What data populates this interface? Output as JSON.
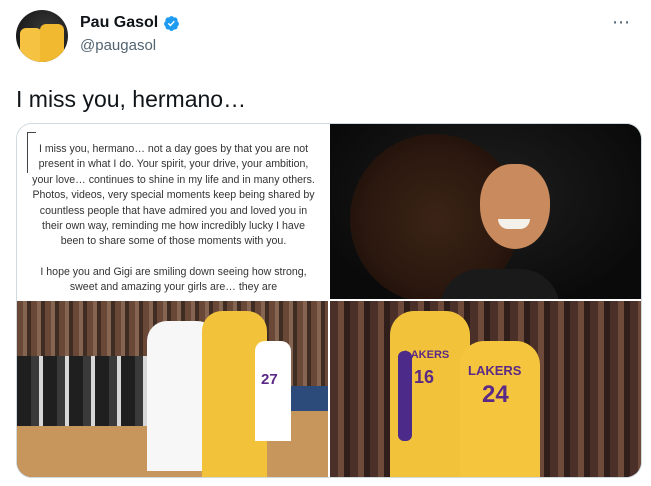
{
  "tweet": {
    "display_name": "Pau Gasol",
    "handle": "@paugasol",
    "text": "I miss you, hermano…",
    "more_icon": "⋯"
  },
  "media": {
    "letter": {
      "paragraph1": "I miss you, hermano… not a day goes by that you are not present in what I do. Your spirit, your drive, your ambition, your love… continues to shine in my life and in many others. Photos, videos, very special moments keep being shared by countless people that have admired you and loved you in their own way, reminding me how incredibly lucky I have been to share some of those moments with you.",
      "paragraph2": "I hope you and Gigi are smiling down seeing how strong, sweet and amazing your girls are… they are"
    },
    "photo_hug": {
      "jersey_number": "27"
    },
    "photo_lakers": {
      "brand": "LAKERS",
      "number_left": "16",
      "number_right": "24"
    }
  },
  "colors": {
    "verified_blue": "#1d9bf0",
    "lakers_gold": "#f2c23b",
    "lakers_purple": "#5b2a86"
  }
}
